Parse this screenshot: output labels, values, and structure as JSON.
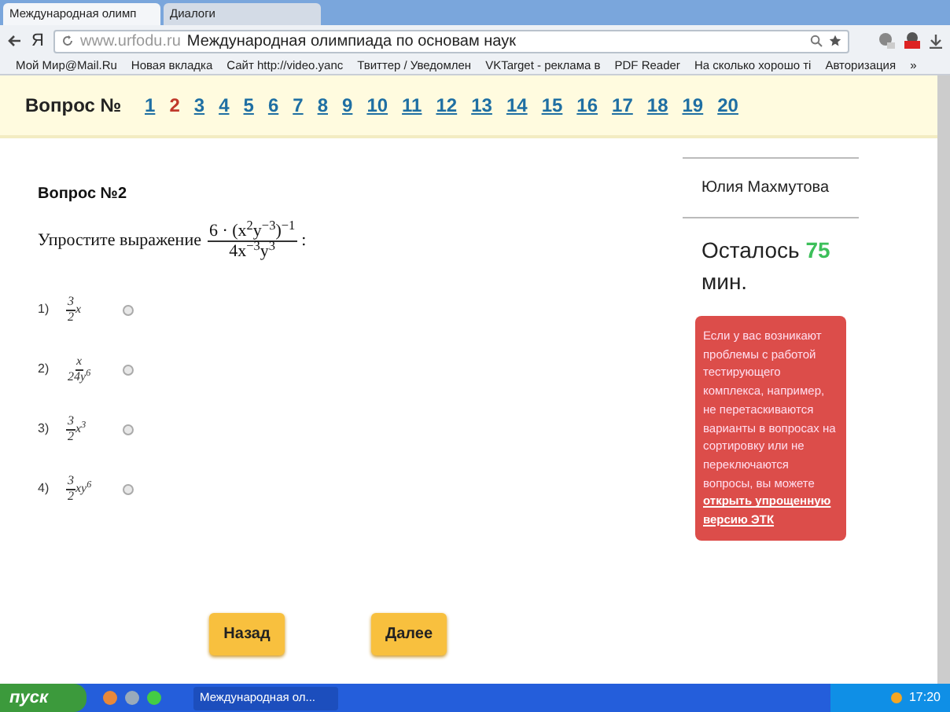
{
  "tabs": [
    {
      "label": "Международная олимп",
      "selected": true
    },
    {
      "label": "Диалоги",
      "selected": false
    }
  ],
  "address_bar": {
    "logo": "Я",
    "domain": "www.urfodu.ru",
    "title": "Международная олимпиада по основам наук"
  },
  "bookmarks": [
    "Мой Мир@Mail.Ru",
    "Новая вкладка",
    "Сайт http://video.yanc",
    "Твиттер / Уведомлен",
    "VKTarget - реклама в",
    "PDF Reader",
    "На сколько хорошо ті",
    "Авторизация",
    "»"
  ],
  "question_nav": {
    "label": "Вопрос №",
    "numbers": [
      {
        "label": "1",
        "selected": false
      },
      {
        "label": "2",
        "selected": true
      },
      {
        "label": "3",
        "selected": false
      },
      {
        "label": "4",
        "selected": false
      },
      {
        "label": "5",
        "selected": false
      },
      {
        "label": "6",
        "selected": false
      },
      {
        "label": "7",
        "selected": false
      },
      {
        "label": "8",
        "selected": false
      },
      {
        "label": "9",
        "selected": false
      },
      {
        "label": "10",
        "selected": false
      },
      {
        "label": "11",
        "selected": false
      },
      {
        "label": "12",
        "selected": false
      },
      {
        "label": "13",
        "selected": false
      },
      {
        "label": "14",
        "selected": false
      },
      {
        "label": "15",
        "selected": false
      },
      {
        "label": "16",
        "selected": false
      },
      {
        "label": "17",
        "selected": false
      },
      {
        "label": "18",
        "selected": false
      },
      {
        "label": "19",
        "selected": false
      },
      {
        "label": "20",
        "selected": false
      }
    ]
  },
  "question": {
    "heading": "Вопрос №2",
    "prompt": "Упростите выражение",
    "expression": {
      "numerator": "6 · (x$^{2}$y$^{−3}$)$^{−1}$",
      "denominator": "4x$^{−3}$y$^{3}$",
      "suffix": ":"
    },
    "options": [
      {
        "number": "1)",
        "numerator": "3",
        "denominator": "2",
        "after": "x",
        "selected": false
      },
      {
        "number": "2)",
        "numerator": "x",
        "denominator": "24y$^{6}$",
        "selected": false
      },
      {
        "number": "3)",
        "numerator": "3",
        "denominator": "2",
        "after": "x$^{3}$",
        "selected": false
      },
      {
        "number": "4)",
        "numerator": "3",
        "denominator": "2",
        "after": "xy$^{6}$",
        "selected": false
      }
    ]
  },
  "sidebar": {
    "user_name": "Юлия Махмутова",
    "time_left": {
      "prefix": "Осталось",
      "minutes": "75",
      "suffix": "мин."
    },
    "notice": {
      "text": "Если у вас возникают проблемы с работой тестирующего комплекса, например, не перетаскиваются варианты в вопросах на сортировку или не переключаются вопросы, вы можете",
      "link": "открыть упрощенную версию ЭТК"
    }
  },
  "buttons": [
    "Назад",
    "Далее"
  ],
  "taskbar": {
    "start": "пуск",
    "window": "Международная ол...",
    "clock": "17:20"
  }
}
